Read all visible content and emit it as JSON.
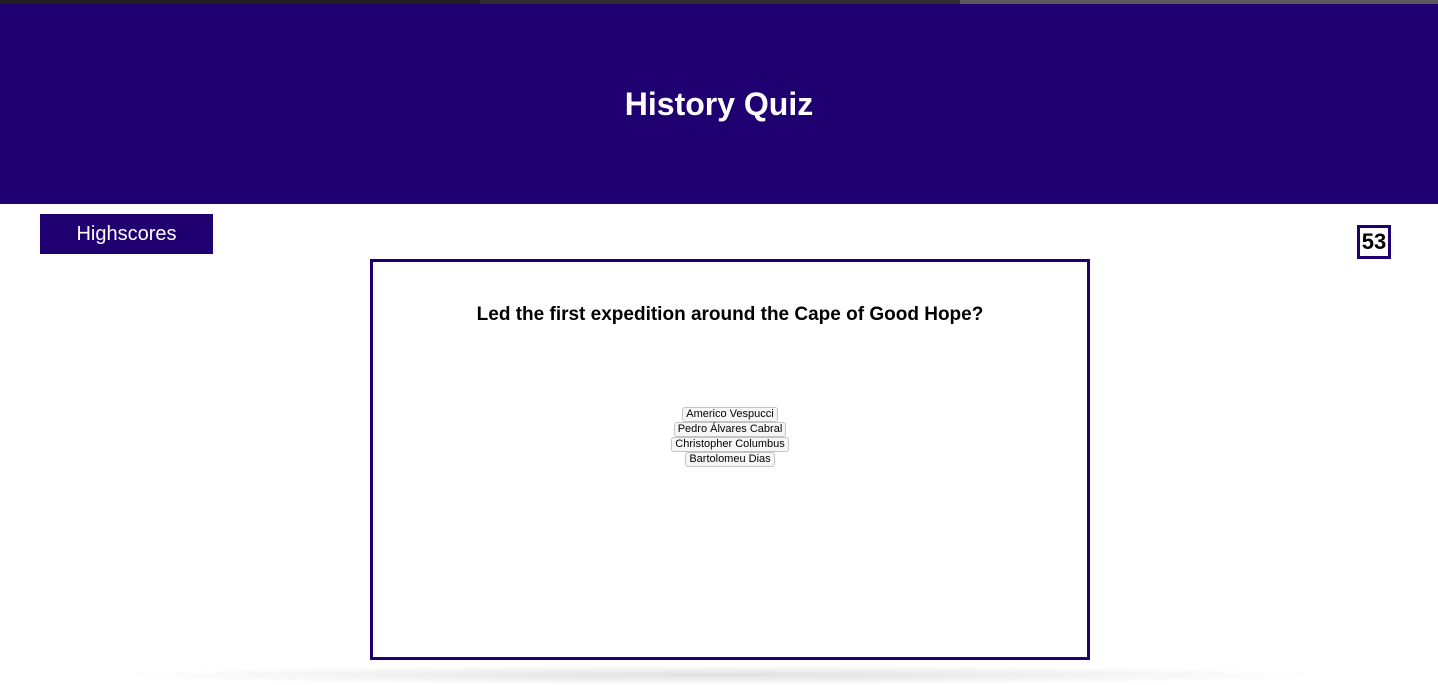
{
  "header": {
    "title": "History Quiz"
  },
  "nav": {
    "highscores_label": "Highscores"
  },
  "timer": {
    "value": "53"
  },
  "quiz": {
    "question": "Led the first expedition around the Cape of Good Hope?",
    "answers": [
      "Americo Vespucci",
      "Pedro Álvares Cabral",
      "Christopher Columbus",
      "Bartolomeu Dias"
    ]
  },
  "colors": {
    "brand": "#200071",
    "background": "#ffffff",
    "header_text": "#ffffff"
  }
}
